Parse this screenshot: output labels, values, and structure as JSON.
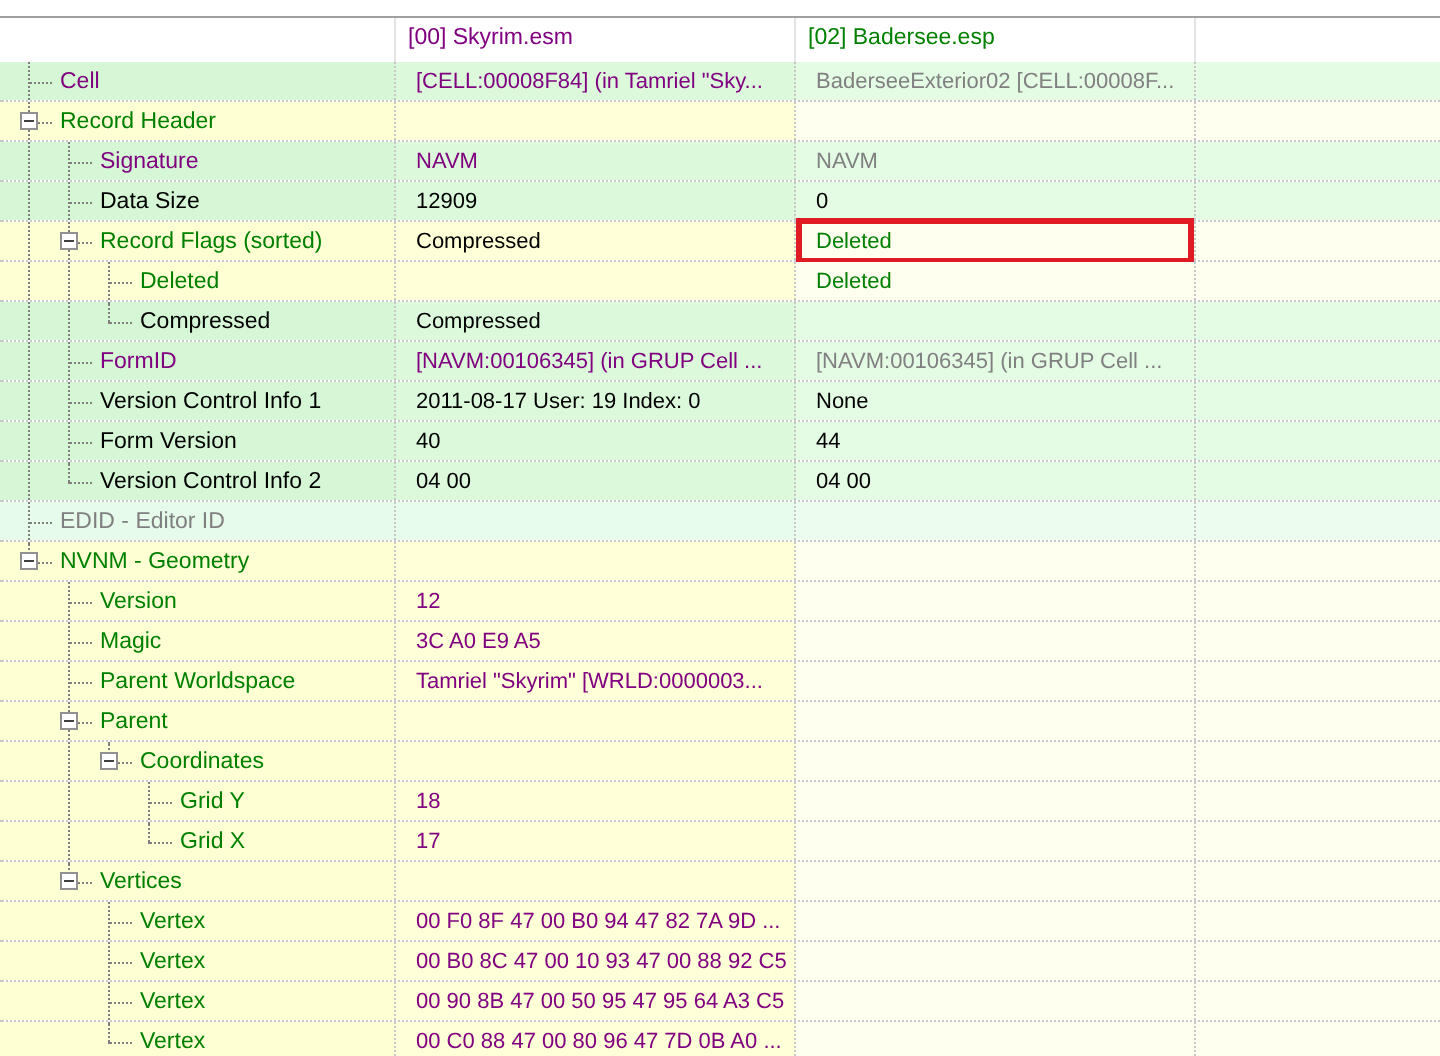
{
  "columns": [
    {
      "label": "[00] Skyrim.esm",
      "color": "#800080"
    },
    {
      "label": "[02] Badersee.esp",
      "color": "#008000"
    }
  ],
  "rows": [
    {
      "name": "Cell",
      "color": "#800080",
      "kind": "match",
      "flagged": false,
      "values": [
        {
          "text": "[CELL:00008F84] (in Tamriel \"Sky...",
          "color": "#800080"
        },
        {
          "text": "BaderseeExterior02 [CELL:00008F...",
          "color": "#808080"
        }
      ]
    },
    {
      "name": "Record Header",
      "color": "#008000",
      "kind": "conflict",
      "flagged": false,
      "expanded": true,
      "children": [
        {
          "name": "Signature",
          "color": "#800080",
          "kind": "match",
          "flagged": false,
          "values": [
            {
              "text": "NAVM",
              "color": "#800080"
            },
            {
              "text": "NAVM",
              "color": "#808080"
            }
          ]
        },
        {
          "name": "Data Size",
          "color": "#000000",
          "kind": "match",
          "flagged": false,
          "values": [
            {
              "text": "12909",
              "color": "#000000"
            },
            {
              "text": "0",
              "color": "#000000"
            }
          ]
        },
        {
          "name": "Record Flags (sorted)",
          "color": "#008000",
          "kind": "conflict",
          "flagged": true,
          "expanded": true,
          "values": [
            {
              "text": "Compressed",
              "color": "#000000"
            },
            {
              "text": "Deleted",
              "color": "#008000"
            }
          ],
          "children": [
            {
              "name": "Deleted",
              "color": "#008000",
              "kind": "conflict",
              "flagged": false,
              "values": [
                {
                  "text": "Deleted",
                  "color": "#008000",
                  "kind": "skip"
                }
              ]
            },
            {
              "name": "Compressed",
              "color": "#000000",
              "kind": "match",
              "flagged": false,
              "values": [
                {
                  "text": "Compressed",
                  "color": "#000000"
                }
              ]
            }
          ]
        },
        {
          "name": "FormID",
          "color": "#800080",
          "kind": "match",
          "flagged": false,
          "values": [
            {
              "text": "[NAVM:00106345] (in GRUP Cell ...",
              "color": "#800080"
            },
            {
              "text": "[NAVM:00106345] (in GRUP Cell ...",
              "color": "#808080"
            }
          ]
        },
        {
          "name": "Version Control Info 1",
          "color": "#000000",
          "kind": "match",
          "flagged": false,
          "values": [
            {
              "text": "2011-08-17 User: 19 Index: 0",
              "color": "#000000"
            },
            {
              "text": "None",
              "color": "#000000"
            }
          ]
        },
        {
          "name": "Form Version",
          "color": "#000000",
          "kind": "match",
          "flagged": false,
          "values": [
            {
              "text": "40",
              "color": "#000000"
            },
            {
              "text": "44",
              "color": "#000000"
            }
          ]
        },
        {
          "name": "Version Control Info 2",
          "color": "#000000",
          "kind": "match",
          "flagged": false,
          "values": [
            {
              "text": "04 00",
              "color": "#000000"
            },
            {
              "text": "04 00",
              "color": "#000000"
            }
          ]
        }
      ]
    },
    {
      "name": "EDID - Editor ID",
      "color": "#808080",
      "kind": "empty",
      "flagged": false
    },
    {
      "name": "NVNM - Geometry",
      "color": "#008000",
      "kind": "conflict",
      "flagged": false,
      "expanded": true,
      "children": [
        {
          "name": "Version",
          "color": "#008000",
          "kind": "conflict",
          "flagged": false,
          "values": [
            {
              "text": "12",
              "color": "#800080"
            }
          ]
        },
        {
          "name": "Magic",
          "color": "#008000",
          "kind": "conflict",
          "flagged": false,
          "values": [
            {
              "text": "3C A0 E9 A5",
              "color": "#800080"
            }
          ]
        },
        {
          "name": "Parent Worldspace",
          "color": "#008000",
          "kind": "conflict",
          "flagged": false,
          "values": [
            {
              "text": "Tamriel \"Skyrim\" [WRLD:0000003...",
              "color": "#800080"
            }
          ]
        },
        {
          "name": "Parent",
          "color": "#008000",
          "kind": "conflict",
          "flagged": false,
          "expanded": true,
          "children": [
            {
              "name": "Coordinates",
              "color": "#008000",
              "kind": "conflict",
              "flagged": false,
              "expanded": true,
              "children": [
                {
                  "name": "Grid Y",
                  "color": "#008000",
                  "kind": "conflict",
                  "flagged": false,
                  "values": [
                    {
                      "text": "18",
                      "color": "#800080"
                    }
                  ]
                },
                {
                  "name": "Grid X",
                  "color": "#008000",
                  "kind": "conflict",
                  "flagged": false,
                  "values": [
                    {
                      "text": "17",
                      "color": "#800080"
                    }
                  ]
                }
              ]
            }
          ]
        },
        {
          "name": "Vertices",
          "color": "#008000",
          "kind": "conflict",
          "flagged": false,
          "expanded": true,
          "children": [
            {
              "name": "Vertex",
              "color": "#008000",
              "kind": "conflict",
              "flagged": false,
              "values": [
                {
                  "text": "00 F0 8F 47 00 B0 94 47 82 7A 9D ...",
                  "color": "#800080"
                }
              ]
            },
            {
              "name": "Vertex",
              "color": "#008000",
              "kind": "conflict",
              "flagged": false,
              "values": [
                {
                  "text": "00 B0 8C 47 00 10 93 47 00 88 92 C5",
                  "color": "#800080"
                }
              ]
            },
            {
              "name": "Vertex",
              "color": "#008000",
              "kind": "conflict",
              "flagged": false,
              "values": [
                {
                  "text": "00 90 8B 47 00 50 95 47 95 64 A3 C5",
                  "color": "#800080"
                }
              ]
            },
            {
              "name": "Vertex",
              "color": "#008000",
              "kind": "conflict",
              "flagged": false,
              "values": [
                {
                  "text": "00 C0 88 47 00 80 96 47 7D 0B A0 ...",
                  "color": "#800080"
                }
              ]
            }
          ]
        }
      ]
    }
  ]
}
